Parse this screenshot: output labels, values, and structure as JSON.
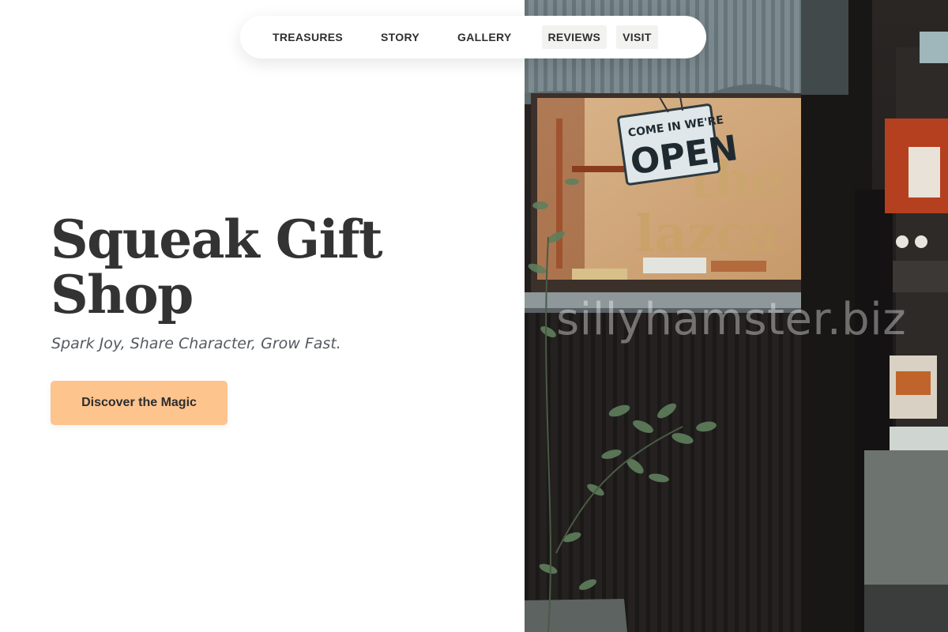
{
  "nav": {
    "items": [
      {
        "label": "TREASURES"
      },
      {
        "label": "STORY"
      },
      {
        "label": "GALLERY"
      },
      {
        "label": "REVIEWS"
      },
      {
        "label": "VISIT"
      }
    ]
  },
  "hero": {
    "title": "Squeak Gift Shop",
    "tagline": "Spark Joy, Share Character, Grow Fast.",
    "cta_label": "Discover the Magic"
  },
  "photo": {
    "sign_line1": "COME IN WE'RE",
    "sign_line2": "OPEN",
    "wall_letters": "the\nlazca",
    "watermark": "sillyhamster.biz"
  },
  "colors": {
    "cta_background": "#fdc48e",
    "title_text": "#333333",
    "tagline_text": "#555a60"
  }
}
